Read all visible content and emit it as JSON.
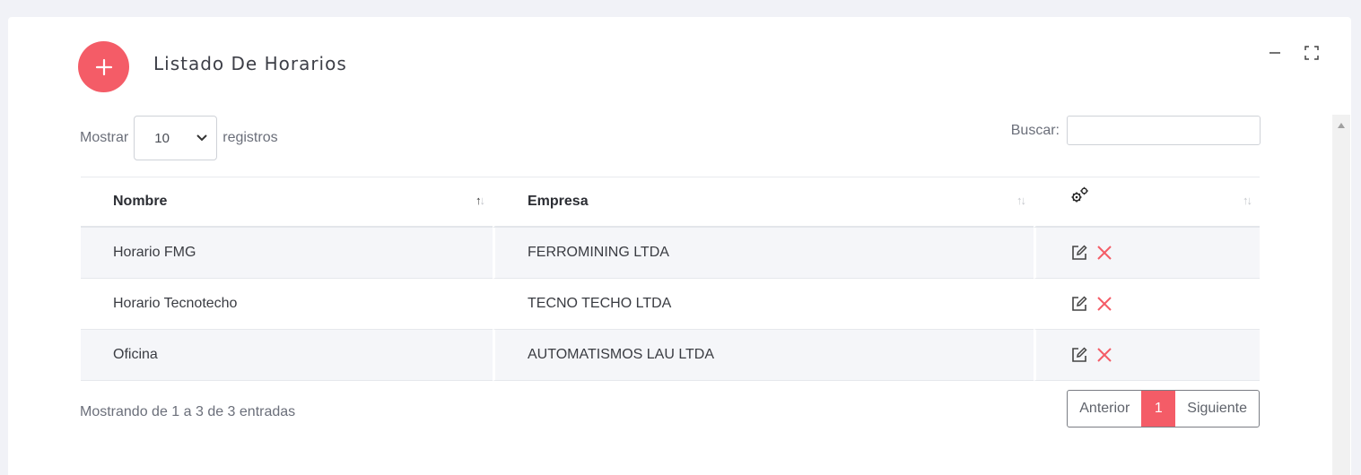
{
  "card": {
    "title": "Listado De Horarios",
    "add_icon": "plus-icon",
    "minimize_icon": "minus-icon",
    "fullscreen_icon": "expand-icon"
  },
  "length": {
    "prefix": "Mostrar",
    "value": "10",
    "suffix": "registros"
  },
  "search": {
    "label": "Buscar:",
    "value": "",
    "placeholder": ""
  },
  "table": {
    "columns": [
      "Nombre",
      "Empresa",
      "gears-icon"
    ],
    "rows": [
      {
        "nombre": "Horario FMG",
        "empresa": "FERROMINING LTDA"
      },
      {
        "nombre": "Horario Tecnotecho",
        "empresa": "TECNO TECHO LTDA"
      },
      {
        "nombre": "Oficina",
        "empresa": "AUTOMATISMOS LAU LTDA"
      }
    ],
    "row_actions": [
      "edit-icon",
      "delete-icon"
    ]
  },
  "footer": {
    "info": "Mostrando de 1 a 3 de 3 entradas",
    "prev": "Anterior",
    "page": "1",
    "next": "Siguiente"
  },
  "colors": {
    "accent": "#f45c67",
    "delete": "#f45c67"
  }
}
